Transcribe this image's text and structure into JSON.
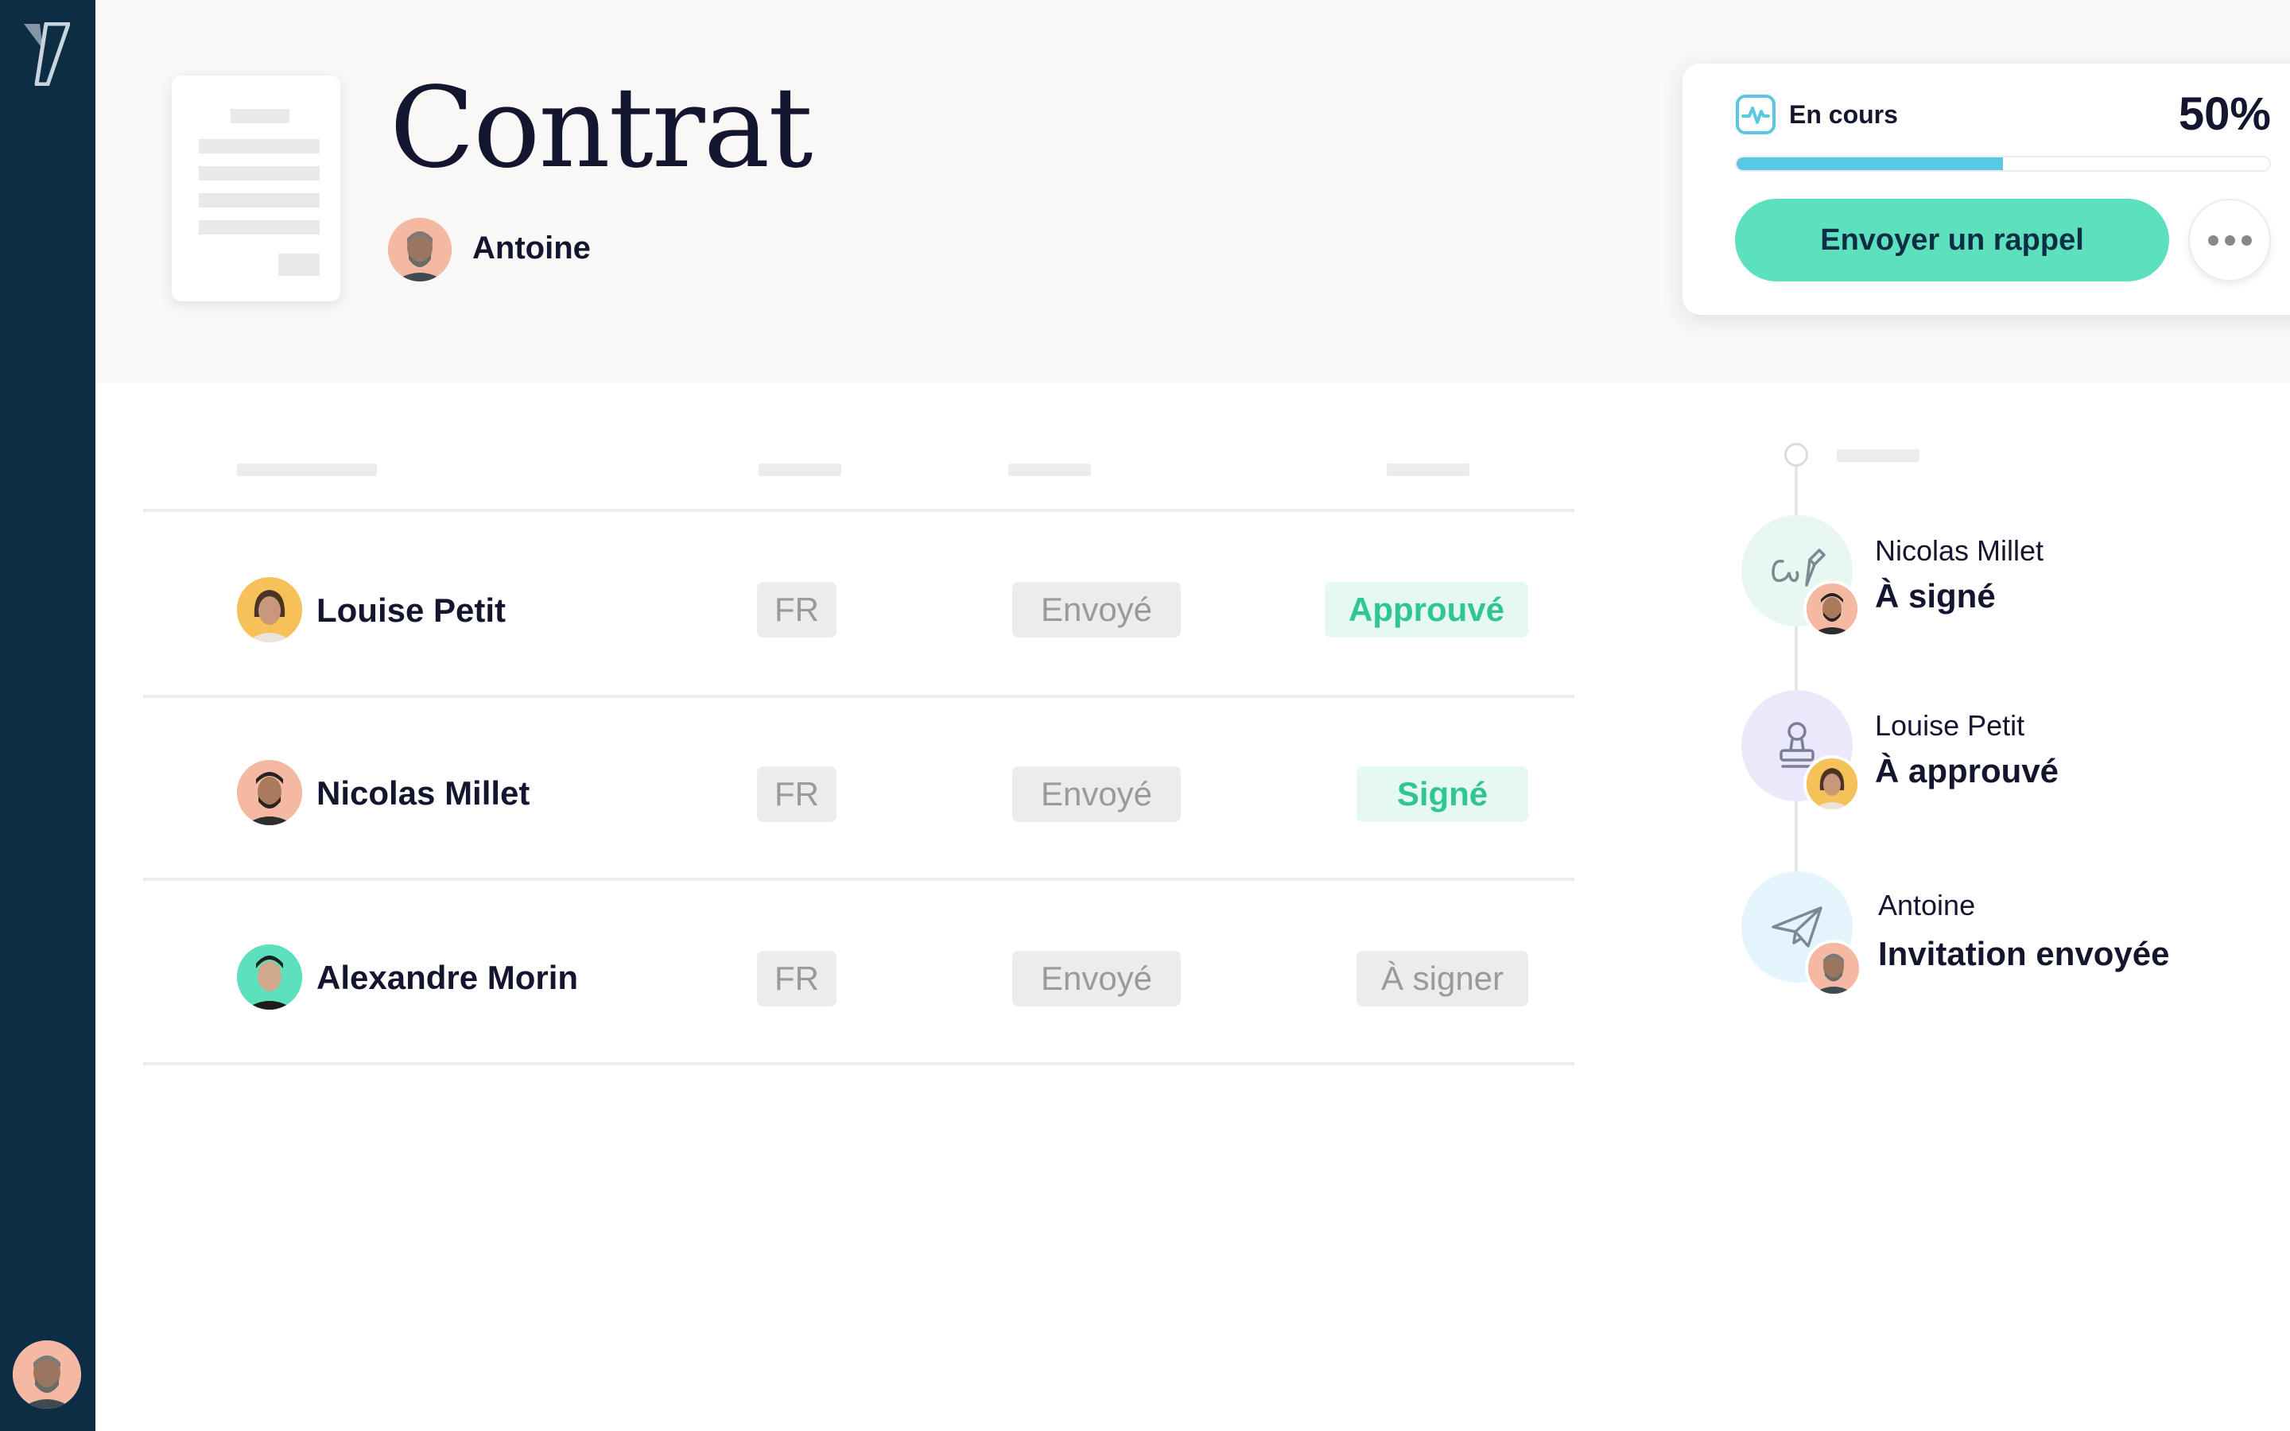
{
  "document": {
    "title": "Contrat",
    "owner": "Antoine"
  },
  "status": {
    "label": "En cours",
    "percent_label": "50%",
    "progress": 0.5,
    "reminder_button": "Envoyer un rappel",
    "accent_color": "#5de0bd",
    "progress_color": "#5ac8e0"
  },
  "signers": [
    {
      "name": "Louise Petit",
      "language": "FR",
      "delivery": "Envoyé",
      "state": "Approuvé",
      "state_style": "green",
      "avatar_color": "#f7c15a"
    },
    {
      "name": "Nicolas Millet",
      "language": "FR",
      "delivery": "Envoyé",
      "state": "Signé",
      "state_style": "green",
      "avatar_color": "#f3b9a3"
    },
    {
      "name": "Alexandre Morin",
      "language": "FR",
      "delivery": "Envoyé",
      "state": "À signer",
      "state_style": "grey",
      "avatar_color": "#5de0bd"
    }
  ],
  "timeline": [
    {
      "actor": "Nicolas Millet",
      "action": "À signé",
      "icon": "signature-icon",
      "icon_bg": "#e8f7f1"
    },
    {
      "actor": "Louise Petit",
      "action": "À approuvé",
      "icon": "stamp-icon",
      "icon_bg": "#ebe8fb"
    },
    {
      "actor": "Antoine",
      "action": "Invitation envoyée",
      "icon": "paper-plane-icon",
      "icon_bg": "#e4f4fc"
    }
  ]
}
